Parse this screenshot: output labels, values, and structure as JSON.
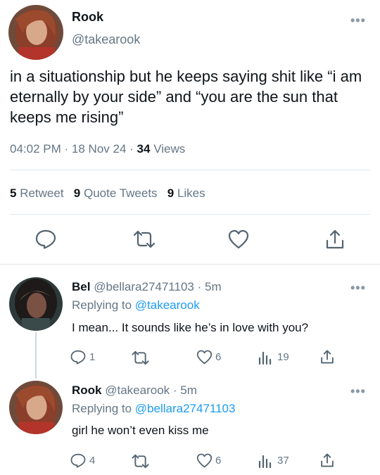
{
  "main_tweet": {
    "display_name": "Rook",
    "handle": "@takearook",
    "more": "•••",
    "text": "in a situationship but he keeps saying shit like “i am eternally by your side” and “you are the sun that keeps me rising”",
    "time": "04:02 PM",
    "sep1": "·",
    "date": "18 Nov 24",
    "sep2": "·",
    "views_count": "34",
    "views_label": "Views",
    "retweets_count": "5",
    "retweets_label": "Retweet",
    "quotes_count": "9",
    "quotes_label": "Quote Tweets",
    "likes_count": "9",
    "likes_label": "Likes"
  },
  "replies": [
    {
      "display_name": "Bel",
      "handle": "@bellara27471103",
      "sep": "·",
      "age": "5m",
      "replying_prefix": "Replying to",
      "replying_handle": "@takearook",
      "text": "I mean... It sounds like he’s in love with you?",
      "reply_count": "1",
      "like_count": "6",
      "view_count": "19",
      "more": "•••"
    },
    {
      "display_name": "Rook",
      "handle": "@takearook",
      "sep": "·",
      "age": "5m",
      "replying_prefix": "Replying to",
      "replying_handle": "@bellara27471103",
      "text": "girl he won’t even kiss me",
      "reply_count": "4",
      "like_count": "6",
      "view_count": "37",
      "more": "•••"
    }
  ],
  "colors": {
    "accent": "#1d9bf0",
    "muted": "#657786",
    "divider": "#e1e8ed",
    "icon": "#536471"
  },
  "icons": {
    "reply": "reply-icon",
    "retweet": "retweet-icon",
    "like": "heart-icon",
    "share": "share-icon",
    "views": "views-icon",
    "more": "more-icon"
  }
}
